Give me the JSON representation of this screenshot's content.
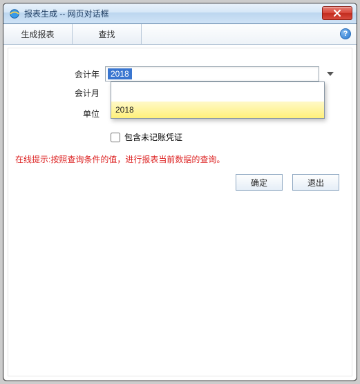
{
  "window": {
    "title": "报表生成 -- 网页对话框",
    "close_label": "✕"
  },
  "toolbar": {
    "generate_label": "生成报表",
    "search_label": "查找",
    "help_label": "?"
  },
  "form": {
    "year_label": "会计年",
    "year_value": "2018",
    "month_label": "会计月",
    "unit_label": "单位",
    "include_unposted_label": "包含未记账凭证"
  },
  "dropdown": {
    "options": [
      "",
      "2018"
    ],
    "highlighted": "2018"
  },
  "hint": "在线提示:按照查询条件的值，进行报表当前数据的查询。",
  "buttons": {
    "ok_label": "确定",
    "exit_label": "退出"
  }
}
